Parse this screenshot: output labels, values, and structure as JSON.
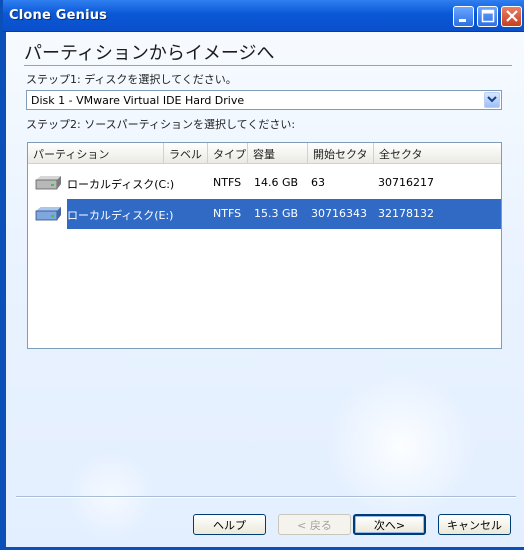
{
  "window": {
    "title": "Clone Genius",
    "controls": {
      "minimize": "minimize-icon",
      "maximize": "maximize-icon",
      "close": "close-icon"
    }
  },
  "page": {
    "title": "パーティションからイメージへ"
  },
  "step1": {
    "label": "ステップ1: ディスクを選択してください。",
    "disk_select": {
      "value": "Disk 1 - VMware Virtual IDE Hard Drive"
    }
  },
  "step2": {
    "label": "ステップ2: ソースパーティションを選択してください:",
    "columns": [
      "パーティション",
      "ラベル",
      "タイプ",
      "容量",
      "開始セクタ",
      "全セクタ"
    ],
    "rows": [
      {
        "name": "ローカルディスク(C:)",
        "label": "",
        "type": "NTFS",
        "capacity": "14.6 GB",
        "start_sector": "63",
        "total_sectors": "30716217",
        "selected": false,
        "icon": "hard-drive-icon"
      },
      {
        "name": "ローカルディスク(E:)",
        "label": "",
        "type": "NTFS",
        "capacity": "15.3 GB",
        "start_sector": "30716343",
        "total_sectors": "32178132",
        "selected": true,
        "icon": "hard-drive-icon"
      }
    ]
  },
  "buttons": {
    "help": "ヘルプ",
    "back": "< 戻る",
    "next": "次へ>",
    "cancel": "キャンセル"
  },
  "colors": {
    "selection": "#316ac5",
    "titlebar": "#0a58d6"
  }
}
